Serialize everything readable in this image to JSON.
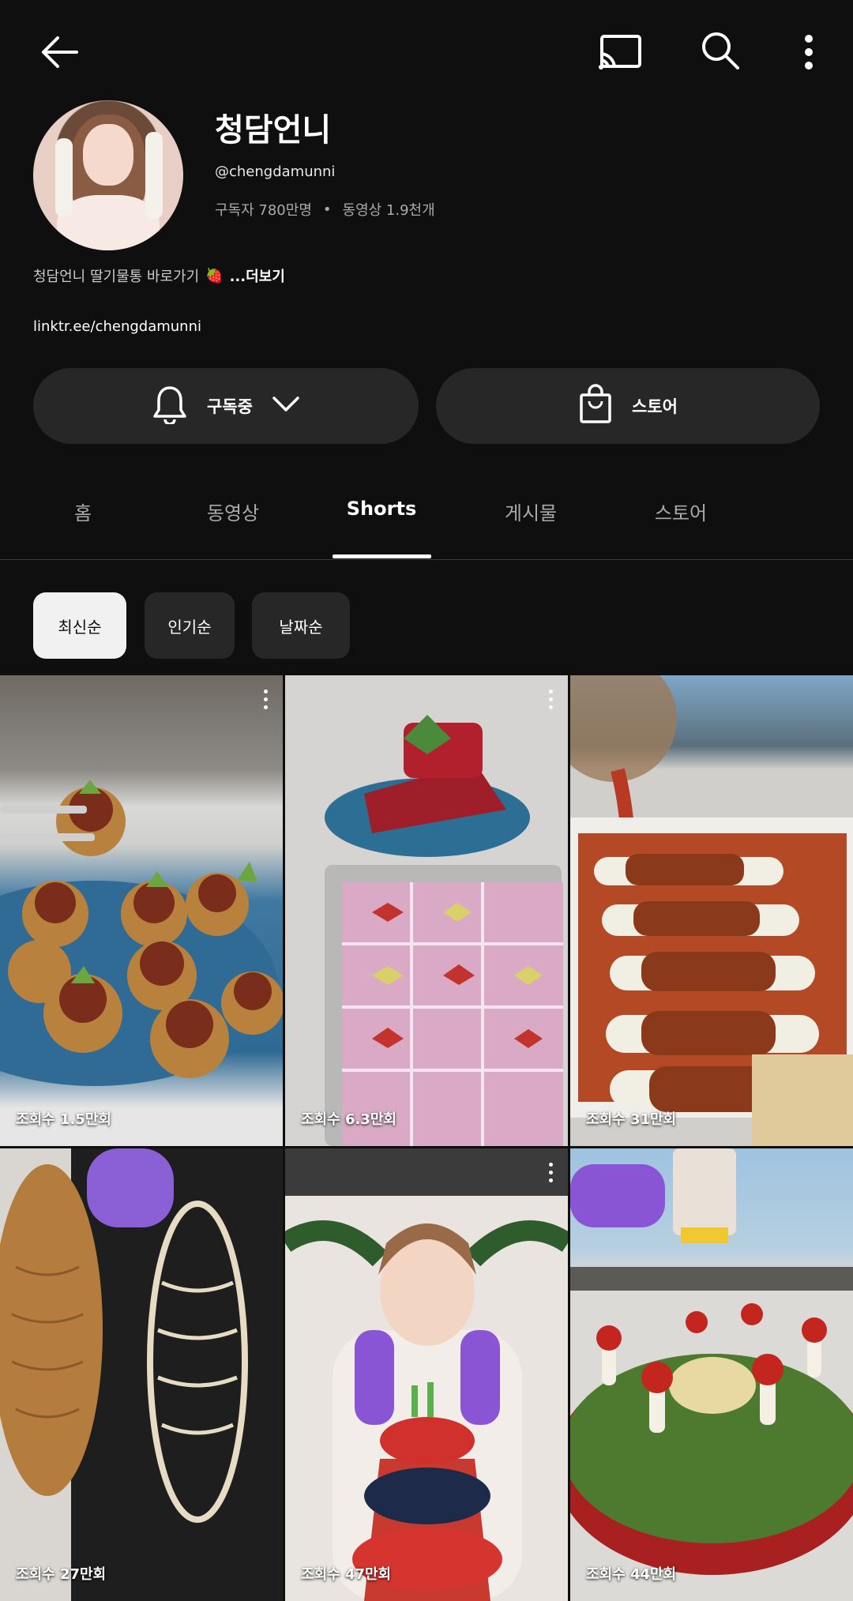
{
  "header": {
    "back_icon": "arrow-left-icon",
    "cast_icon": "cast-icon",
    "search_icon": "search-icon",
    "more_icon": "more-vertical-icon"
  },
  "channel": {
    "name": "청담언니",
    "handle": "@chengdamunni",
    "subscribers": "구독자 780만명",
    "separator": "•",
    "videos": "동영상 1.9천개",
    "description": "청담언니 딸기물통 바로가기",
    "description_emoji": "🍓",
    "more": "...더보기",
    "link": "linktr.ee/chengdamunni"
  },
  "actions": {
    "subscribe_label": "구독중",
    "store_label": "스토어"
  },
  "tabs": [
    {
      "label": "홈"
    },
    {
      "label": "동영상"
    },
    {
      "label": "Shorts"
    },
    {
      "label": "게시물"
    },
    {
      "label": "스토어"
    }
  ],
  "sort_chips": [
    {
      "label": "최신순"
    },
    {
      "label": "인기순"
    },
    {
      "label": "날짜순"
    }
  ],
  "shorts": [
    {
      "views": "조회수 1.5만회"
    },
    {
      "views": "조회수 6.3만회"
    },
    {
      "views": "조회수 31만회"
    },
    {
      "views": "조회수 27만회"
    },
    {
      "views": "조회수 47만회"
    },
    {
      "views": "조회수 44만회"
    }
  ],
  "colors": {
    "background": "#0f0f0f",
    "surface": "#272727",
    "chip_selected": "#f1f1f1",
    "text_secondary": "#aaaaaa"
  }
}
